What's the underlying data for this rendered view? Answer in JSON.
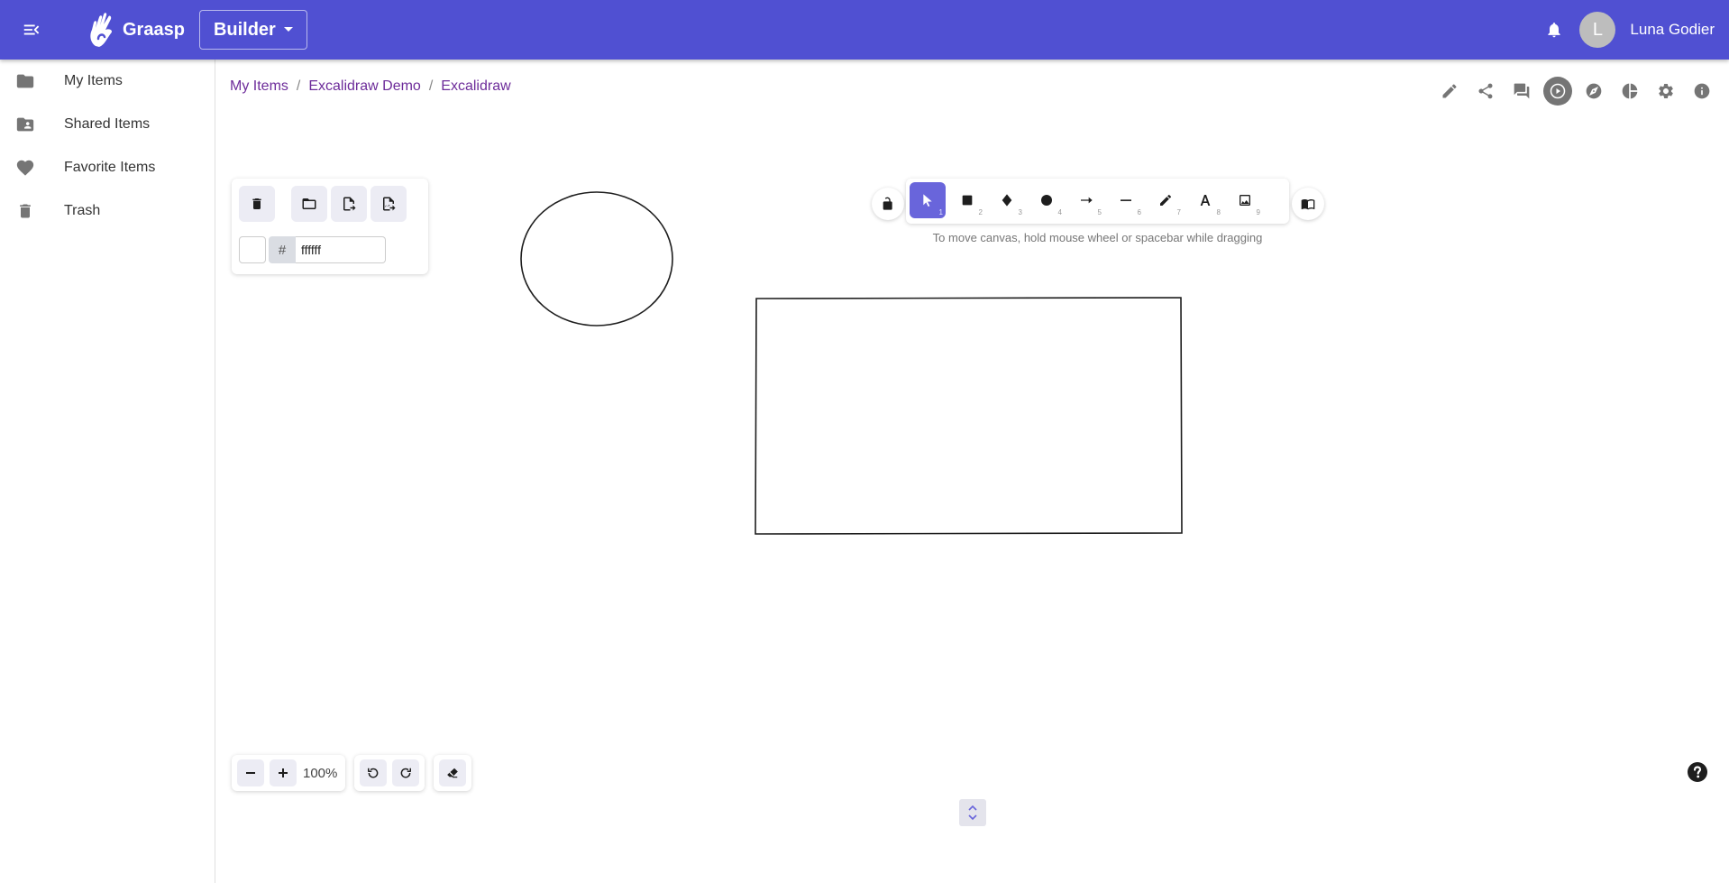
{
  "appbar": {
    "brand": "Graasp",
    "context_label": "Builder",
    "avatar_initial": "L",
    "username": "Luna Godier",
    "color": "#5050d2"
  },
  "sidebar": {
    "items": [
      {
        "label": "My Items",
        "icon": "folder-icon"
      },
      {
        "label": "Shared Items",
        "icon": "shared-folder-icon"
      },
      {
        "label": "Favorite Items",
        "icon": "heart-icon"
      },
      {
        "label": "Trash",
        "icon": "trash-icon"
      }
    ]
  },
  "breadcrumb": [
    "My Items",
    "Excalidraw Demo",
    "Excalidraw"
  ],
  "breadcrumb_separator": "/",
  "item_actions": [
    "edit-icon",
    "share-icon",
    "chat-icon",
    "play-icon",
    "explore-icon",
    "analytics-icon",
    "settings-icon",
    "info-icon"
  ],
  "excalidraw": {
    "panel": {
      "buttons": [
        "trash-icon",
        "open-folder-icon",
        "export-file-icon",
        "export-image-icon"
      ],
      "hash_symbol": "#",
      "background_hex": "ffffff"
    },
    "toolbar": {
      "tools": [
        {
          "name": "selection",
          "key": "1",
          "active": true
        },
        {
          "name": "rectangle",
          "key": "2"
        },
        {
          "name": "diamond",
          "key": "3"
        },
        {
          "name": "ellipse",
          "key": "4"
        },
        {
          "name": "arrow",
          "key": "5"
        },
        {
          "name": "line",
          "key": "6"
        },
        {
          "name": "pencil",
          "key": "7"
        },
        {
          "name": "text",
          "key": "8"
        },
        {
          "name": "image",
          "key": "9"
        }
      ],
      "accent": "#6965db"
    },
    "hint": "To move canvas, hold mouse wheel or spacebar while dragging",
    "zoom": {
      "value": "100%"
    }
  }
}
